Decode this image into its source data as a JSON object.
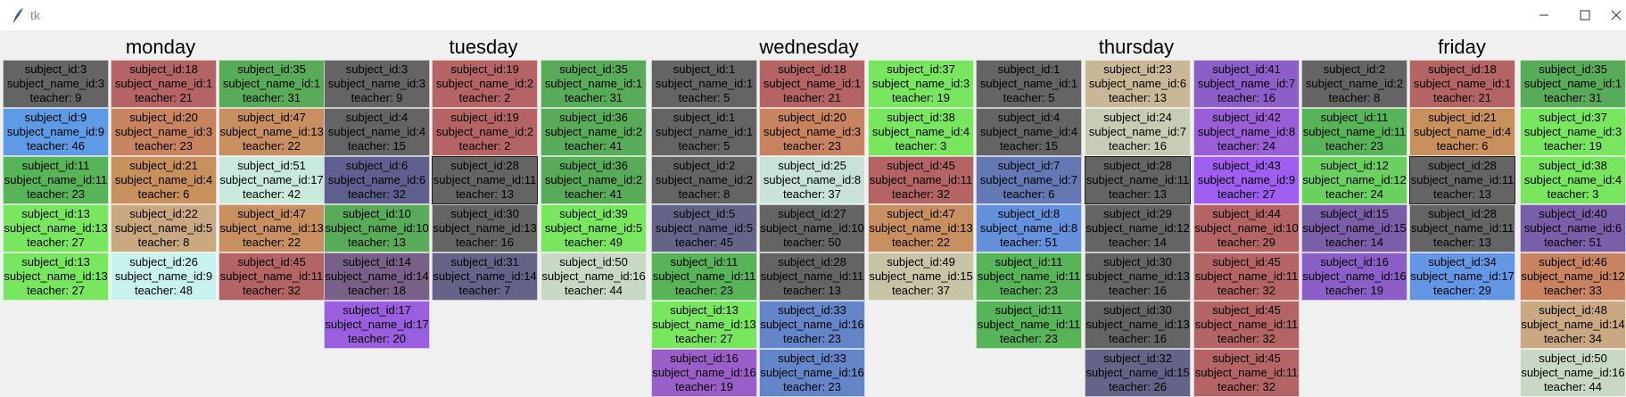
{
  "window": {
    "title": "tk"
  },
  "days": [
    "monday",
    "tuesday",
    "wednesday",
    "thursday",
    "friday"
  ],
  "columns": [
    {
      "cells": [
        {
          "sid": "subject_id:3",
          "sname": "subject_name_id:3",
          "teacher": "teacher: 9",
          "color": "#646464"
        },
        {
          "sid": "subject_id:9",
          "sname": "subject_name_id:9",
          "teacher": "teacher: 46",
          "color": "#5f9ae6"
        },
        {
          "sid": "subject_id:11",
          "sname": "subject_name_id:11",
          "teacher": "teacher: 23",
          "color": "#58b458"
        },
        {
          "sid": "subject_id:13",
          "sname": "subject_name_id:13",
          "teacher": "teacher: 27",
          "color": "#79e660"
        },
        {
          "sid": "subject_id:13",
          "sname": "subject_name_id:13",
          "teacher": "teacher: 27",
          "color": "#79e660"
        }
      ]
    },
    {
      "cells": [
        {
          "sid": "subject_id:18",
          "sname": "subject_name_id:1",
          "teacher": "teacher: 21",
          "color": "#b46464"
        },
        {
          "sid": "subject_id:20",
          "sname": "subject_name_id:3",
          "teacher": "teacher: 23",
          "color": "#c88460"
        },
        {
          "sid": "subject_id:21",
          "sname": "subject_name_id:4",
          "teacher": "teacher: 6",
          "color": "#c8905c"
        },
        {
          "sid": "subject_id:22",
          "sname": "subject_name_id:5",
          "teacher": "teacher: 8",
          "color": "#caa882"
        },
        {
          "sid": "subject_id:26",
          "sname": "subject_name_id:9",
          "teacher": "teacher: 48",
          "color": "#c7f2ee"
        }
      ]
    },
    {
      "cells": [
        {
          "sid": "subject_id:35",
          "sname": "subject_name_id:1",
          "teacher": "teacher: 31",
          "color": "#58ab58"
        },
        {
          "sid": "subject_id:47",
          "sname": "subject_name_id:13",
          "teacher": "teacher: 22",
          "color": "#c89060"
        },
        {
          "sid": "subject_id:51",
          "sname": "subject_name_id:17",
          "teacher": "teacher: 42",
          "color": "#c8eadc"
        },
        {
          "sid": "subject_id:47",
          "sname": "subject_name_id:13",
          "teacher": "teacher: 22",
          "color": "#c89060"
        },
        {
          "sid": "subject_id:45",
          "sname": "subject_name_id:11",
          "teacher": "teacher: 32",
          "color": "#b46464"
        }
      ]
    },
    {
      "cells": [
        {
          "sid": "subject_id:3",
          "sname": "subject_name_id:3",
          "teacher": "teacher: 9",
          "color": "#646464"
        },
        {
          "sid": "subject_id:4",
          "sname": "subject_name_id:4",
          "teacher": "teacher: 15",
          "color": "#646464"
        },
        {
          "sid": "subject_id:6",
          "sname": "subject_name_id:6",
          "teacher": "teacher: 32",
          "color": "#606090"
        },
        {
          "sid": "subject_id:10",
          "sname": "subject_name_id:10",
          "teacher": "teacher: 13",
          "color": "#58ab58"
        },
        {
          "sid": "subject_id:14",
          "sname": "subject_name_id:14",
          "teacher": "teacher: 18",
          "color": "#786088"
        },
        {
          "sid": "subject_id:17",
          "sname": "subject_name_id:17",
          "teacher": "teacher: 20",
          "color": "#9a5fde"
        }
      ]
    },
    {
      "cells": [
        {
          "sid": "subject_id:19",
          "sname": "subject_name_id:2",
          "teacher": "teacher: 2",
          "color": "#b46464"
        },
        {
          "sid": "subject_id:19",
          "sname": "subject_name_id:2",
          "teacher": "teacher: 2",
          "color": "#b46464"
        },
        {
          "sid": "subject_id:28",
          "sname": "subject_name_id:11",
          "teacher": "teacher: 13",
          "color": "#646464",
          "sunken": true
        },
        {
          "sid": "subject_id:30",
          "sname": "subject_name_id:13",
          "teacher": "teacher: 16",
          "color": "#646464"
        },
        {
          "sid": "subject_id:31",
          "sname": "subject_name_id:14",
          "teacher": "teacher: 7",
          "color": "#646488"
        }
      ]
    },
    {
      "cells": [
        {
          "sid": "subject_id:35",
          "sname": "subject_name_id:1",
          "teacher": "teacher: 31",
          "color": "#58ab58"
        },
        {
          "sid": "subject_id:36",
          "sname": "subject_name_id:2",
          "teacher": "teacher: 41",
          "color": "#58ab58"
        },
        {
          "sid": "subject_id:36",
          "sname": "subject_name_id:2",
          "teacher": "teacher: 41",
          "color": "#58ab58"
        },
        {
          "sid": "subject_id:39",
          "sname": "subject_name_id:5",
          "teacher": "teacher: 49",
          "color": "#79e660"
        },
        {
          "sid": "subject_id:50",
          "sname": "subject_name_id:16",
          "teacher": "teacher: 44",
          "color": "#c8d8c4"
        }
      ]
    },
    {
      "cells": [
        {
          "sid": "subject_id:1",
          "sname": "subject_name_id:1",
          "teacher": "teacher: 5",
          "color": "#646464"
        },
        {
          "sid": "subject_id:1",
          "sname": "subject_name_id:1",
          "teacher": "teacher: 5",
          "color": "#646464"
        },
        {
          "sid": "subject_id:2",
          "sname": "subject_name_id:2",
          "teacher": "teacher: 8",
          "color": "#646464"
        },
        {
          "sid": "subject_id:5",
          "sname": "subject_name_id:5",
          "teacher": "teacher: 45",
          "color": "#646488"
        },
        {
          "sid": "subject_id:11",
          "sname": "subject_name_id:11",
          "teacher": "teacher: 23",
          "color": "#58b458"
        },
        {
          "sid": "subject_id:13",
          "sname": "subject_name_id:13",
          "teacher": "teacher: 27",
          "color": "#79e660"
        },
        {
          "sid": "subject_id:16",
          "sname": "subject_name_id:16",
          "teacher": "teacher: 19",
          "color": "#9a5ec8"
        }
      ]
    },
    {
      "cells": [
        {
          "sid": "subject_id:18",
          "sname": "subject_name_id:1",
          "teacher": "teacher: 21",
          "color": "#b46464"
        },
        {
          "sid": "subject_id:20",
          "sname": "subject_name_id:3",
          "teacher": "teacher: 23",
          "color": "#c88460"
        },
        {
          "sid": "subject_id:25",
          "sname": "subject_name_id:8",
          "teacher": "teacher: 37",
          "color": "#c8e2d8"
        },
        {
          "sid": "subject_id:27",
          "sname": "subject_name_id:10",
          "teacher": "teacher: 50",
          "color": "#646464"
        },
        {
          "sid": "subject_id:28",
          "sname": "subject_name_id:11",
          "teacher": "teacher: 13",
          "color": "#646464"
        },
        {
          "sid": "subject_id:33",
          "sname": "subject_name_id:16",
          "teacher": "teacher: 23",
          "color": "#6486c8"
        },
        {
          "sid": "subject_id:33",
          "sname": "subject_name_id:16",
          "teacher": "teacher: 23",
          "color": "#6486c8"
        }
      ]
    },
    {
      "cells": [
        {
          "sid": "subject_id:37",
          "sname": "subject_name_id:3",
          "teacher": "teacher: 19",
          "color": "#79e660"
        },
        {
          "sid": "subject_id:38",
          "sname": "subject_name_id:4",
          "teacher": "teacher: 3",
          "color": "#79e660"
        },
        {
          "sid": "subject_id:45",
          "sname": "subject_name_id:11",
          "teacher": "teacher: 32",
          "color": "#b46464"
        },
        {
          "sid": "subject_id:47",
          "sname": "subject_name_id:13",
          "teacher": "teacher: 22",
          "color": "#c89060"
        },
        {
          "sid": "subject_id:49",
          "sname": "subject_name_id:15",
          "teacher": "teacher: 37",
          "color": "#c8c4a6"
        }
      ]
    },
    {
      "cells": [
        {
          "sid": "subject_id:1",
          "sname": "subject_name_id:1",
          "teacher": "teacher: 5",
          "color": "#646464"
        },
        {
          "sid": "subject_id:4",
          "sname": "subject_name_id:4",
          "teacher": "teacher: 15",
          "color": "#646464"
        },
        {
          "sid": "subject_id:7",
          "sname": "subject_name_id:7",
          "teacher": "teacher: 6",
          "color": "#6478b4"
        },
        {
          "sid": "subject_id:8",
          "sname": "subject_name_id:8",
          "teacher": "teacher: 51",
          "color": "#6490dc"
        },
        {
          "sid": "subject_id:11",
          "sname": "subject_name_id:11",
          "teacher": "teacher: 23",
          "color": "#58b458"
        },
        {
          "sid": "subject_id:11",
          "sname": "subject_name_id:11",
          "teacher": "teacher: 23",
          "color": "#58b458"
        }
      ]
    },
    {
      "cells": [
        {
          "sid": "subject_id:23",
          "sname": "subject_name_id:6",
          "teacher": "teacher: 13",
          "color": "#c8b898"
        },
        {
          "sid": "subject_id:24",
          "sname": "subject_name_id:7",
          "teacher": "teacher: 16",
          "color": "#c8ccb4"
        },
        {
          "sid": "subject_id:28",
          "sname": "subject_name_id:11",
          "teacher": "teacher: 13",
          "color": "#646464",
          "sunken": true
        },
        {
          "sid": "subject_id:29",
          "sname": "subject_name_id:12",
          "teacher": "teacher: 14",
          "color": "#646464"
        },
        {
          "sid": "subject_id:30",
          "sname": "subject_name_id:13",
          "teacher": "teacher: 16",
          "color": "#646464"
        },
        {
          "sid": "subject_id:30",
          "sname": "subject_name_id:13",
          "teacher": "teacher: 16",
          "color": "#646464"
        },
        {
          "sid": "subject_id:32",
          "sname": "subject_name_id:15",
          "teacher": "teacher: 26",
          "color": "#646488"
        }
      ]
    },
    {
      "cells": [
        {
          "sid": "subject_id:41",
          "sname": "subject_name_id:7",
          "teacher": "teacher: 16",
          "color": "#8c5ec8"
        },
        {
          "sid": "subject_id:42",
          "sname": "subject_name_id:8",
          "teacher": "teacher: 24",
          "color": "#9a5ed6"
        },
        {
          "sid": "subject_id:43",
          "sname": "subject_name_id:9",
          "teacher": "teacher: 27",
          "color": "#a05ef0"
        },
        {
          "sid": "subject_id:44",
          "sname": "subject_name_id:10",
          "teacher": "teacher: 29",
          "color": "#b46464"
        },
        {
          "sid": "subject_id:45",
          "sname": "subject_name_id:11",
          "teacher": "teacher: 32",
          "color": "#b46464"
        },
        {
          "sid": "subject_id:45",
          "sname": "subject_name_id:11",
          "teacher": "teacher: 32",
          "color": "#b46464"
        },
        {
          "sid": "subject_id:45",
          "sname": "subject_name_id:11",
          "teacher": "teacher: 32",
          "color": "#b46464"
        }
      ]
    },
    {
      "cells": [
        {
          "sid": "subject_id:2",
          "sname": "subject_name_id:2",
          "teacher": "teacher: 8",
          "color": "#646464"
        },
        {
          "sid": "subject_id:11",
          "sname": "subject_name_id:11",
          "teacher": "teacher: 23",
          "color": "#58b458"
        },
        {
          "sid": "subject_id:12",
          "sname": "subject_name_id:12",
          "teacher": "teacher: 24",
          "color": "#6ad060"
        },
        {
          "sid": "subject_id:15",
          "sname": "subject_name_id:15",
          "teacher": "teacher: 14",
          "color": "#7a5ea8"
        },
        {
          "sid": "subject_id:16",
          "sname": "subject_name_id:16",
          "teacher": "teacher: 19",
          "color": "#8c5ec8"
        }
      ]
    },
    {
      "cells": [
        {
          "sid": "subject_id:18",
          "sname": "subject_name_id:1",
          "teacher": "teacher: 21",
          "color": "#b46464"
        },
        {
          "sid": "subject_id:21",
          "sname": "subject_name_id:4",
          "teacher": "teacher: 6",
          "color": "#c8905c"
        },
        {
          "sid": "subject_id:28",
          "sname": "subject_name_id:11",
          "teacher": "teacher: 13",
          "color": "#646464",
          "sunken": true
        },
        {
          "sid": "subject_id:28",
          "sname": "subject_name_id:11",
          "teacher": "teacher: 13",
          "color": "#646464"
        },
        {
          "sid": "subject_id:34",
          "sname": "subject_name_id:17",
          "teacher": "teacher: 29",
          "color": "#6496e6"
        }
      ]
    },
    {
      "cells": [
        {
          "sid": "subject_id:35",
          "sname": "subject_name_id:1",
          "teacher": "teacher: 31",
          "color": "#58ab58"
        },
        {
          "sid": "subject_id:37",
          "sname": "subject_name_id:3",
          "teacher": "teacher: 19",
          "color": "#79e660"
        },
        {
          "sid": "subject_id:38",
          "sname": "subject_name_id:4",
          "teacher": "teacher: 3",
          "color": "#79e660"
        },
        {
          "sid": "subject_id:40",
          "sname": "subject_name_id:6",
          "teacher": "teacher: 51",
          "color": "#7a5ea8"
        },
        {
          "sid": "subject_id:46",
          "sname": "subject_name_id:12",
          "teacher": "teacher: 33",
          "color": "#c88460"
        },
        {
          "sid": "subject_id:48",
          "sname": "subject_name_id:14",
          "teacher": "teacher: 34",
          "color": "#caa882"
        },
        {
          "sid": "subject_id:50",
          "sname": "subject_name_id:16",
          "teacher": "teacher: 44",
          "color": "#c8d8c4"
        }
      ]
    }
  ]
}
